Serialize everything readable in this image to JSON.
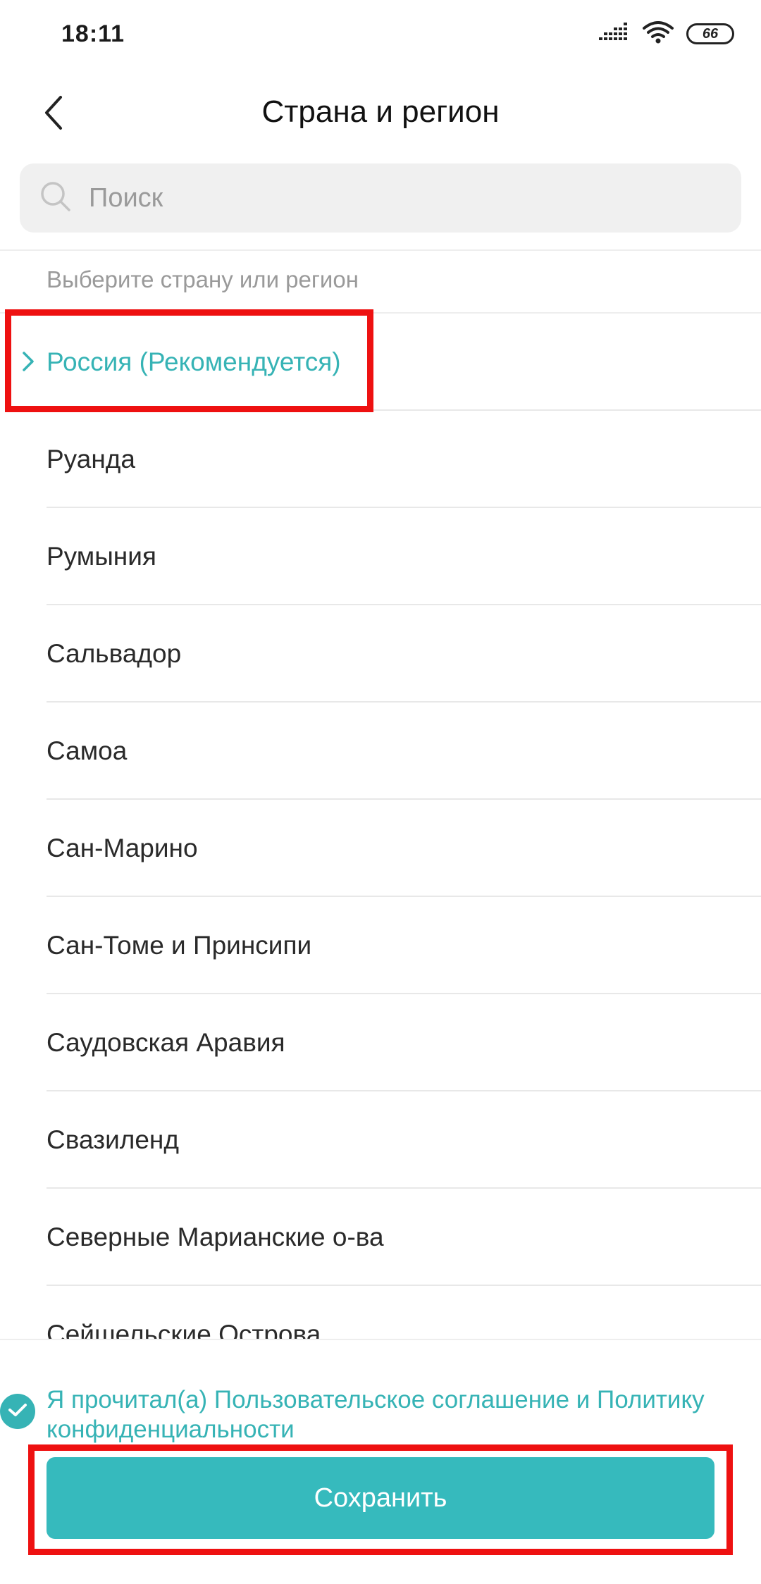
{
  "status_bar": {
    "time": "18:11",
    "battery_level": "66",
    "icons": [
      "signal-icon",
      "wifi-icon",
      "battery-icon"
    ]
  },
  "header": {
    "title": "Страна и регион",
    "back_icon": "chevron-left-icon"
  },
  "search": {
    "placeholder": "Поиск",
    "value": "",
    "icon": "search-icon"
  },
  "section_label": "Выберите страну или регион",
  "countries": [
    {
      "label": "Россия (Рекомендуется)",
      "selected": true
    },
    {
      "label": "Руанда",
      "selected": false
    },
    {
      "label": "Румыния",
      "selected": false
    },
    {
      "label": "Сальвадор",
      "selected": false
    },
    {
      "label": "Самоа",
      "selected": false
    },
    {
      "label": "Сан-Марино",
      "selected": false
    },
    {
      "label": "Сан-Томе и Принсипи",
      "selected": false
    },
    {
      "label": "Саудовская Аравия",
      "selected": false
    },
    {
      "label": "Свазиленд",
      "selected": false
    },
    {
      "label": "Северные Марианские о-ва",
      "selected": false
    },
    {
      "label": "Сейшельские Острова",
      "selected": false
    }
  ],
  "agreement": {
    "text": "Я прочитал(а) Пользовательское соглашение и Политику конфиденциальности",
    "checked": true
  },
  "save_button": {
    "label": "Сохранить"
  },
  "colors": {
    "accent": "#36b3b5",
    "highlight": "#ee1111",
    "search_bg": "#f0f0f0"
  }
}
